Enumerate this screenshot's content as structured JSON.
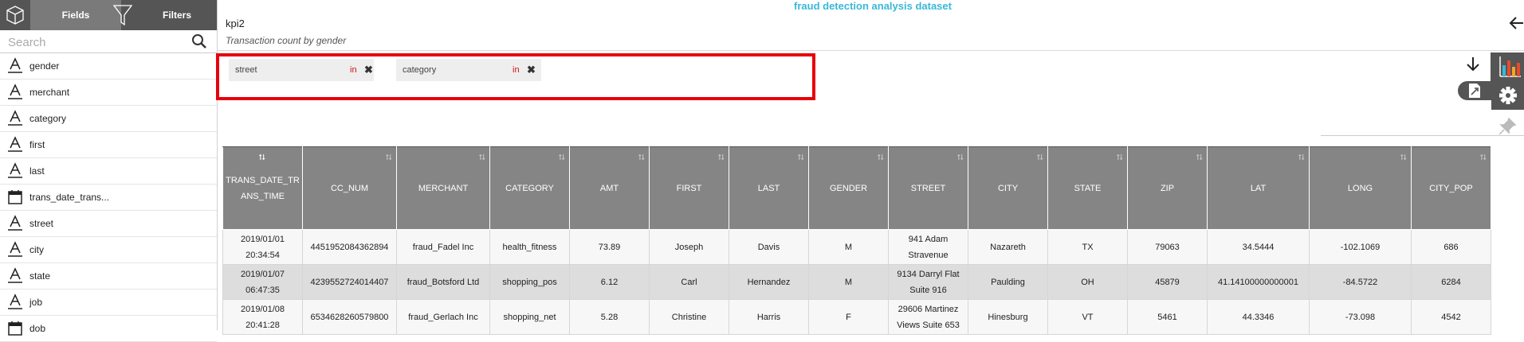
{
  "app": {
    "dataset_title": "fraud detection analysis dataset"
  },
  "left_panel": {
    "tabs": {
      "fields": "Fields",
      "filters": "Filters"
    },
    "search_placeholder": "Search",
    "fields": [
      {
        "label": "gender",
        "type": "text"
      },
      {
        "label": "merchant",
        "type": "text"
      },
      {
        "label": "category",
        "type": "text"
      },
      {
        "label": "first",
        "type": "text"
      },
      {
        "label": "last",
        "type": "text"
      },
      {
        "label": "trans_date_trans...",
        "type": "date"
      },
      {
        "label": "street",
        "type": "text"
      },
      {
        "label": "city",
        "type": "text"
      },
      {
        "label": "state",
        "type": "text"
      },
      {
        "label": "job",
        "type": "text"
      },
      {
        "label": "dob",
        "type": "date"
      }
    ]
  },
  "header": {
    "viz_name": "kpi2",
    "viz_subtitle": "Transaction count by gender"
  },
  "filters": [
    {
      "field": "street",
      "op": "in"
    },
    {
      "field": "category",
      "op": "in"
    }
  ],
  "table": {
    "columns": [
      "TRANS_DATE_TRANS_TIME",
      "CC_NUM",
      "MERCHANT",
      "CATEGORY",
      "AMT",
      "FIRST",
      "LAST",
      "GENDER",
      "STREET",
      "CITY",
      "STATE",
      "ZIP",
      "LAT",
      "LONG",
      "CITY_POP"
    ],
    "rows": [
      [
        "2019/01/01 20:34:54",
        "4451952084362894",
        "fraud_Fadel Inc",
        "health_fitness",
        "73.89",
        "Joseph",
        "Davis",
        "M",
        "941 Adam Stravenue",
        "Nazareth",
        "TX",
        "79063",
        "34.5444",
        "-102.1069",
        "686"
      ],
      [
        "2019/01/07 06:47:35",
        "4239552724014407",
        "fraud_Botsford Ltd",
        "shopping_pos",
        "6.12",
        "Carl",
        "Hernandez",
        "M",
        "9134 Darryl Flat Suite 916",
        "Paulding",
        "OH",
        "45879",
        "41.14100000000001",
        "-84.5722",
        "6284"
      ],
      [
        "2019/01/08 20:41:28",
        "6534628260579800",
        "fraud_Gerlach Inc",
        "shopping_net",
        "5.28",
        "Christine",
        "Harris",
        "F",
        "29606 Martinez Views Suite 653",
        "Hinesburg",
        "VT",
        "5461",
        "44.3346",
        "-73.098",
        "4542"
      ]
    ]
  },
  "colors": {
    "accent": "#3ab8d8",
    "filter_border": "#e8000b",
    "header_bg": "#858585",
    "tab_bg": "#555555"
  }
}
